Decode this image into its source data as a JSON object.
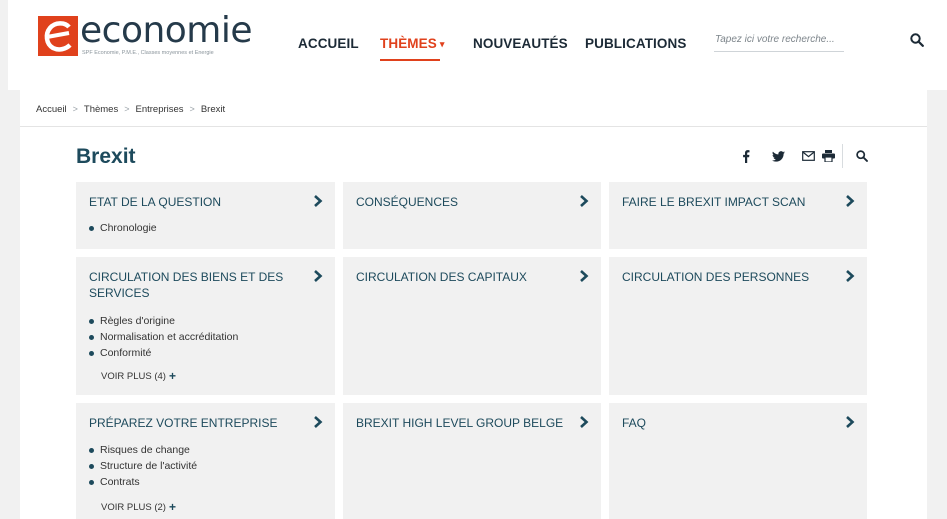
{
  "logo": {
    "text": "economie",
    "subtitle": "SPF Economie, P.M.E., Classes moyennes et Energie"
  },
  "nav": {
    "items": [
      {
        "label": "ACCUEIL"
      },
      {
        "label": "THÈMES",
        "caret": "▾"
      },
      {
        "label": "NOUVEAUTÉS"
      },
      {
        "label": "PUBLICATIONS"
      }
    ]
  },
  "search": {
    "placeholder": "Tapez ici votre recherche..."
  },
  "breadcrumb": {
    "items": [
      "Accueil",
      "Thèmes",
      "Entreprises",
      "Brexit"
    ],
    "separator": ">"
  },
  "page": {
    "title": "Brexit"
  },
  "tools": {
    "icons": [
      "facebook-icon",
      "twitter-icon",
      "mail-icon",
      "print-icon",
      "search-icon"
    ]
  },
  "cards": [
    {
      "title": "ETAT DE LA QUESTION",
      "items": [
        "Chronologie"
      ],
      "more": ""
    },
    {
      "title": "CONSÉQUENCES",
      "items": [],
      "more": ""
    },
    {
      "title": "FAIRE LE BREXIT IMPACT SCAN",
      "items": [],
      "more": ""
    },
    {
      "title": "CIRCULATION DES BIENS ET DES SERVICES",
      "items": [
        "Règles d'origine",
        "Normalisation et accréditation",
        "Conformité"
      ],
      "more": "VOIR PLUS (4)"
    },
    {
      "title": "CIRCULATION DES CAPITAUX",
      "items": [],
      "more": ""
    },
    {
      "title": "CIRCULATION DES PERSONNES",
      "items": [],
      "more": ""
    },
    {
      "title": "PRÉPAREZ VOTRE ENTREPRISE",
      "items": [
        "Risques de change",
        "Structure de l'activité",
        "Contrats"
      ],
      "more": "VOIR PLUS (2)"
    },
    {
      "title": "BREXIT HIGH LEVEL GROUP BELGE",
      "items": [],
      "more": ""
    },
    {
      "title": "FAQ",
      "items": [],
      "more": ""
    }
  ],
  "colors": {
    "accent": "#e0411c",
    "heading": "#1d4a5c",
    "card_bg": "#f1f1f1",
    "page_bg": "#f1f1f1"
  }
}
